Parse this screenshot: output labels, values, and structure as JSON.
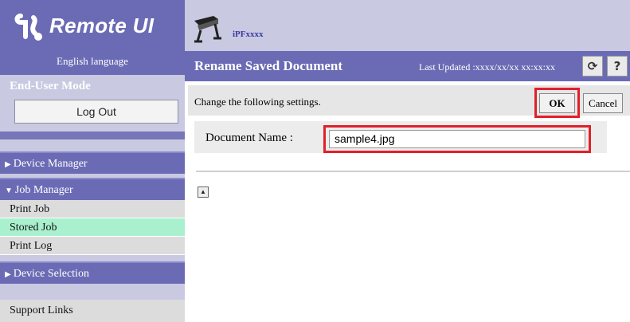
{
  "app": {
    "name": "Remote UI",
    "language": "English language",
    "mode": "End-User Mode",
    "logout_label": "Log Out"
  },
  "header": {
    "model": "iPFxxxx",
    "page_title": "Rename Saved Document",
    "last_updated": "Last Updated :xxxx/xx/xx xx:xx:xx",
    "refresh_glyph": "⟳",
    "help_glyph": "?"
  },
  "sidebar": {
    "device_manager": "Device Manager",
    "job_manager": "Job Manager",
    "job_items": [
      "Print Job",
      "Stored Job",
      "Print Log"
    ],
    "device_selection": "Device Selection",
    "support_links": "Support Links"
  },
  "form": {
    "notice": "Change the following settings.",
    "ok_label": "OK",
    "cancel_label": "Cancel",
    "document_name_label": "Document Name :",
    "document_name_value": "sample4.jpg"
  },
  "colors": {
    "header_purple": "#6b6bb5",
    "sidebar_bg": "#c9c9e2",
    "highlight_red": "#e0202a",
    "active_item": "#a9f0cf"
  }
}
